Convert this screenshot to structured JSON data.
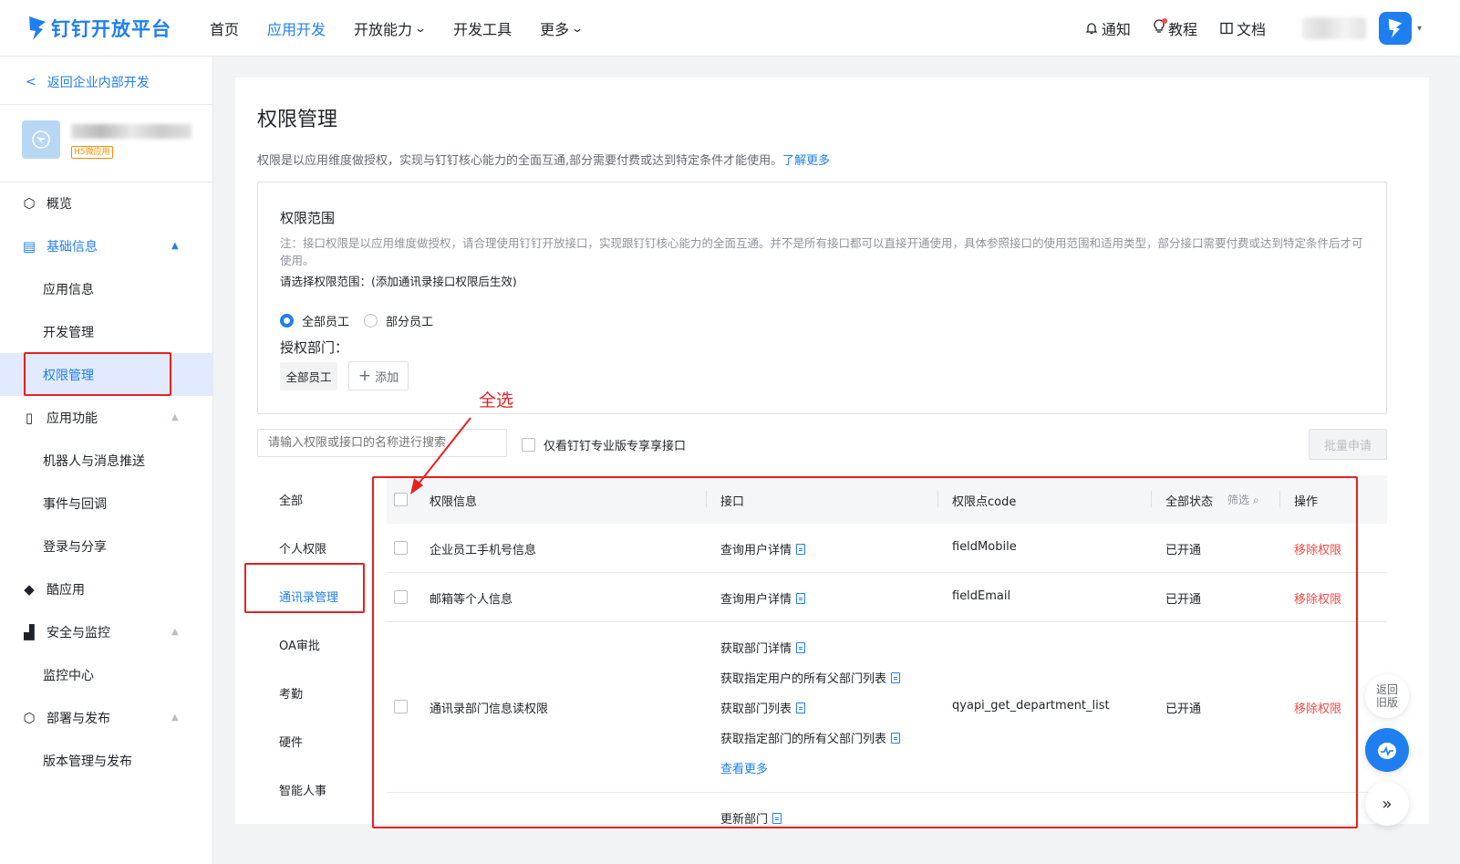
{
  "nav": {
    "brand": "钉钉开放平台",
    "links": [
      "首页",
      "应用开发",
      "开放能力",
      "开发工具",
      "更多"
    ],
    "right": [
      "通知",
      "教程",
      "文档"
    ]
  },
  "sidebar": {
    "back": "返回企业内部开发",
    "app_tag": "H5微应用",
    "items": [
      {
        "label": "概览"
      },
      {
        "label": "基础信息"
      },
      {
        "label": "应用信息"
      },
      {
        "label": "开发管理"
      },
      {
        "label": "权限管理"
      },
      {
        "label": "应用功能"
      },
      {
        "label": "机器人与消息推送"
      },
      {
        "label": "事件与回调"
      },
      {
        "label": "登录与分享"
      },
      {
        "label": "酷应用"
      },
      {
        "label": "安全与监控"
      },
      {
        "label": "监控中心"
      },
      {
        "label": "部署与发布"
      },
      {
        "label": "版本管理与发布"
      }
    ]
  },
  "page": {
    "title": "权限管理",
    "desc": "权限是以应用维度做授权，实现与钉钉核心能力的全面互通,部分需要付费或达到特定条件才能使用。",
    "learn_more": "了解更多"
  },
  "scope": {
    "title": "权限范围",
    "note": "注：接口权限是以应用维度做授权，请合理使用钉钉开放接口，实现跟钉钉核心能力的全面互通。并不是所有接口都可以直接开通使用，具体参照接口的使用范围和适用类型，部分接口需要付费或达到特定条件后才可使用。",
    "choose": "请选择权限范围：(添加通讯录接口权限后生效)",
    "radio_all": "全部员工",
    "radio_part": "部分员工",
    "auth_dept": "授权部门：",
    "chip": "全部员工",
    "add": "添加"
  },
  "toolbar": {
    "search_placeholder": "请输入权限或接口的名称进行搜索",
    "filter_label": "仅看钉钉专业版专享享接口",
    "batch": "批量申请"
  },
  "categories": [
    "全部",
    "个人权限",
    "通讯录管理",
    "OA审批",
    "考勤",
    "硬件",
    "智能人事"
  ],
  "table": {
    "headers": {
      "info": "权限信息",
      "api": "接口",
      "code": "权限点code",
      "status": "全部状态",
      "filter": "筛选",
      "op": "操作"
    },
    "rows": [
      {
        "info": "企业员工手机号信息",
        "apis": [
          "查询用户详情"
        ],
        "code": "fieldMobile",
        "status": "已开通",
        "op": "移除权限"
      },
      {
        "info": "邮箱等个人信息",
        "apis": [
          "查询用户详情"
        ],
        "code": "fieldEmail",
        "status": "已开通",
        "op": "移除权限"
      },
      {
        "info": "通讯录部门信息读权限",
        "apis": [
          "获取部门详情",
          "获取指定用户的所有父部门列表",
          "获取部门列表",
          "获取指定部门的所有父部门列表"
        ],
        "more": "查看更多",
        "code": "qyapi_get_department_list",
        "status": "已开通",
        "op": "移除权限"
      },
      {
        "apis": [
          "更新部门"
        ]
      }
    ]
  },
  "annotation": "全选",
  "float": {
    "old_version": "返回\n旧版"
  },
  "colors": {
    "accent": "#1f7ff0",
    "danger": "#f54a45",
    "annotation": "#e82020"
  }
}
